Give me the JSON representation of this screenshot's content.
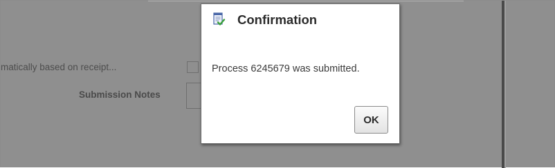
{
  "background": {
    "hint_text": "matically based on receipt...",
    "notes_label": "Submission Notes"
  },
  "dialog": {
    "title": "Confirmation",
    "icon": "document-check-icon",
    "message": "Process 6245679 was submitted.",
    "ok_label": "OK"
  },
  "colors": {
    "overlay": "#8f8f8f",
    "dialog_bg": "#ffffff",
    "title_text": "#2b2b2b",
    "icon_check": "#3aa13a",
    "icon_doc": "#4a67a8"
  }
}
